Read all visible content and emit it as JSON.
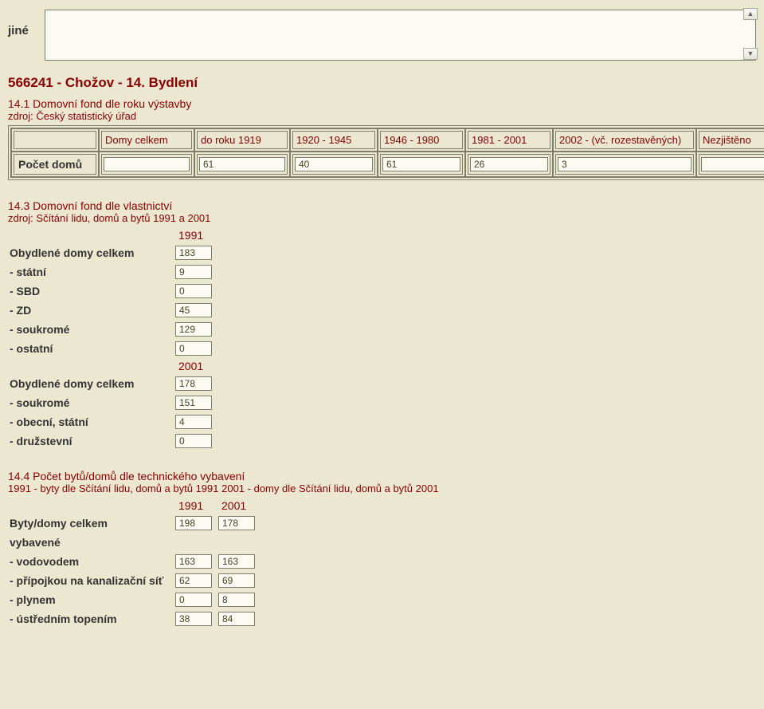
{
  "top": {
    "jine": "jiné",
    "main_title": "566241 - Chožov - 14. Bydlení"
  },
  "s1": {
    "title": "14.1 Domovní fond dle roku výstavby",
    "src": "zdroj: Český statistický úřad",
    "headers": [
      "Domy celkem",
      "do roku 1919",
      "1920 - 1945",
      "1946 - 1980",
      "1981 - 2001",
      "2002 - (vč. rozestavěných)",
      "Nezjištěno"
    ],
    "row_label": "Počet domů",
    "values": [
      "",
      "61",
      "40",
      "61",
      "26",
      "3",
      ""
    ]
  },
  "s3": {
    "title": "14.3 Domovní fond dle vlastnictví",
    "src": "zdroj: Sčítání lidu, domů a bytů 1991 a 2001",
    "year1": "1991",
    "year2": "2001",
    "rows1": [
      {
        "label": "Obydlené domy celkem",
        "val": "183"
      },
      {
        "label": "- státní",
        "val": "9"
      },
      {
        "label": "- SBD",
        "val": "0"
      },
      {
        "label": "- ZD",
        "val": "45"
      },
      {
        "label": "- soukromé",
        "val": "129"
      },
      {
        "label": "- ostatní",
        "val": "0"
      }
    ],
    "rows2": [
      {
        "label": "Obydlené domy celkem",
        "val": "178"
      },
      {
        "label": "- soukromé",
        "val": "151"
      },
      {
        "label": "- obecní, státní",
        "val": "4"
      },
      {
        "label": "- družstevní",
        "val": "0"
      }
    ]
  },
  "s4": {
    "title": "14.4 Počet bytů/domů dle technického vybavení",
    "src": "1991 - byty dle Sčítání lidu, domů a bytů 1991 2001 - domy dle Sčítání lidu, domů a bytů 2001",
    "year1": "1991",
    "year2": "2001",
    "rows": [
      {
        "label": "Byty/domy celkem",
        "v1": "198",
        "v2": "178"
      },
      {
        "label": "vybavené",
        "noval": true
      },
      {
        "label": "- vodovodem",
        "v1": "163",
        "v2": "163"
      },
      {
        "label": "- přípojkou na kanalizační síť",
        "v1": "62",
        "v2": "69"
      },
      {
        "label": "- plynem",
        "v1": "0",
        "v2": "8"
      },
      {
        "label": "- ústředním topením",
        "v1": "38",
        "v2": "84"
      }
    ]
  }
}
